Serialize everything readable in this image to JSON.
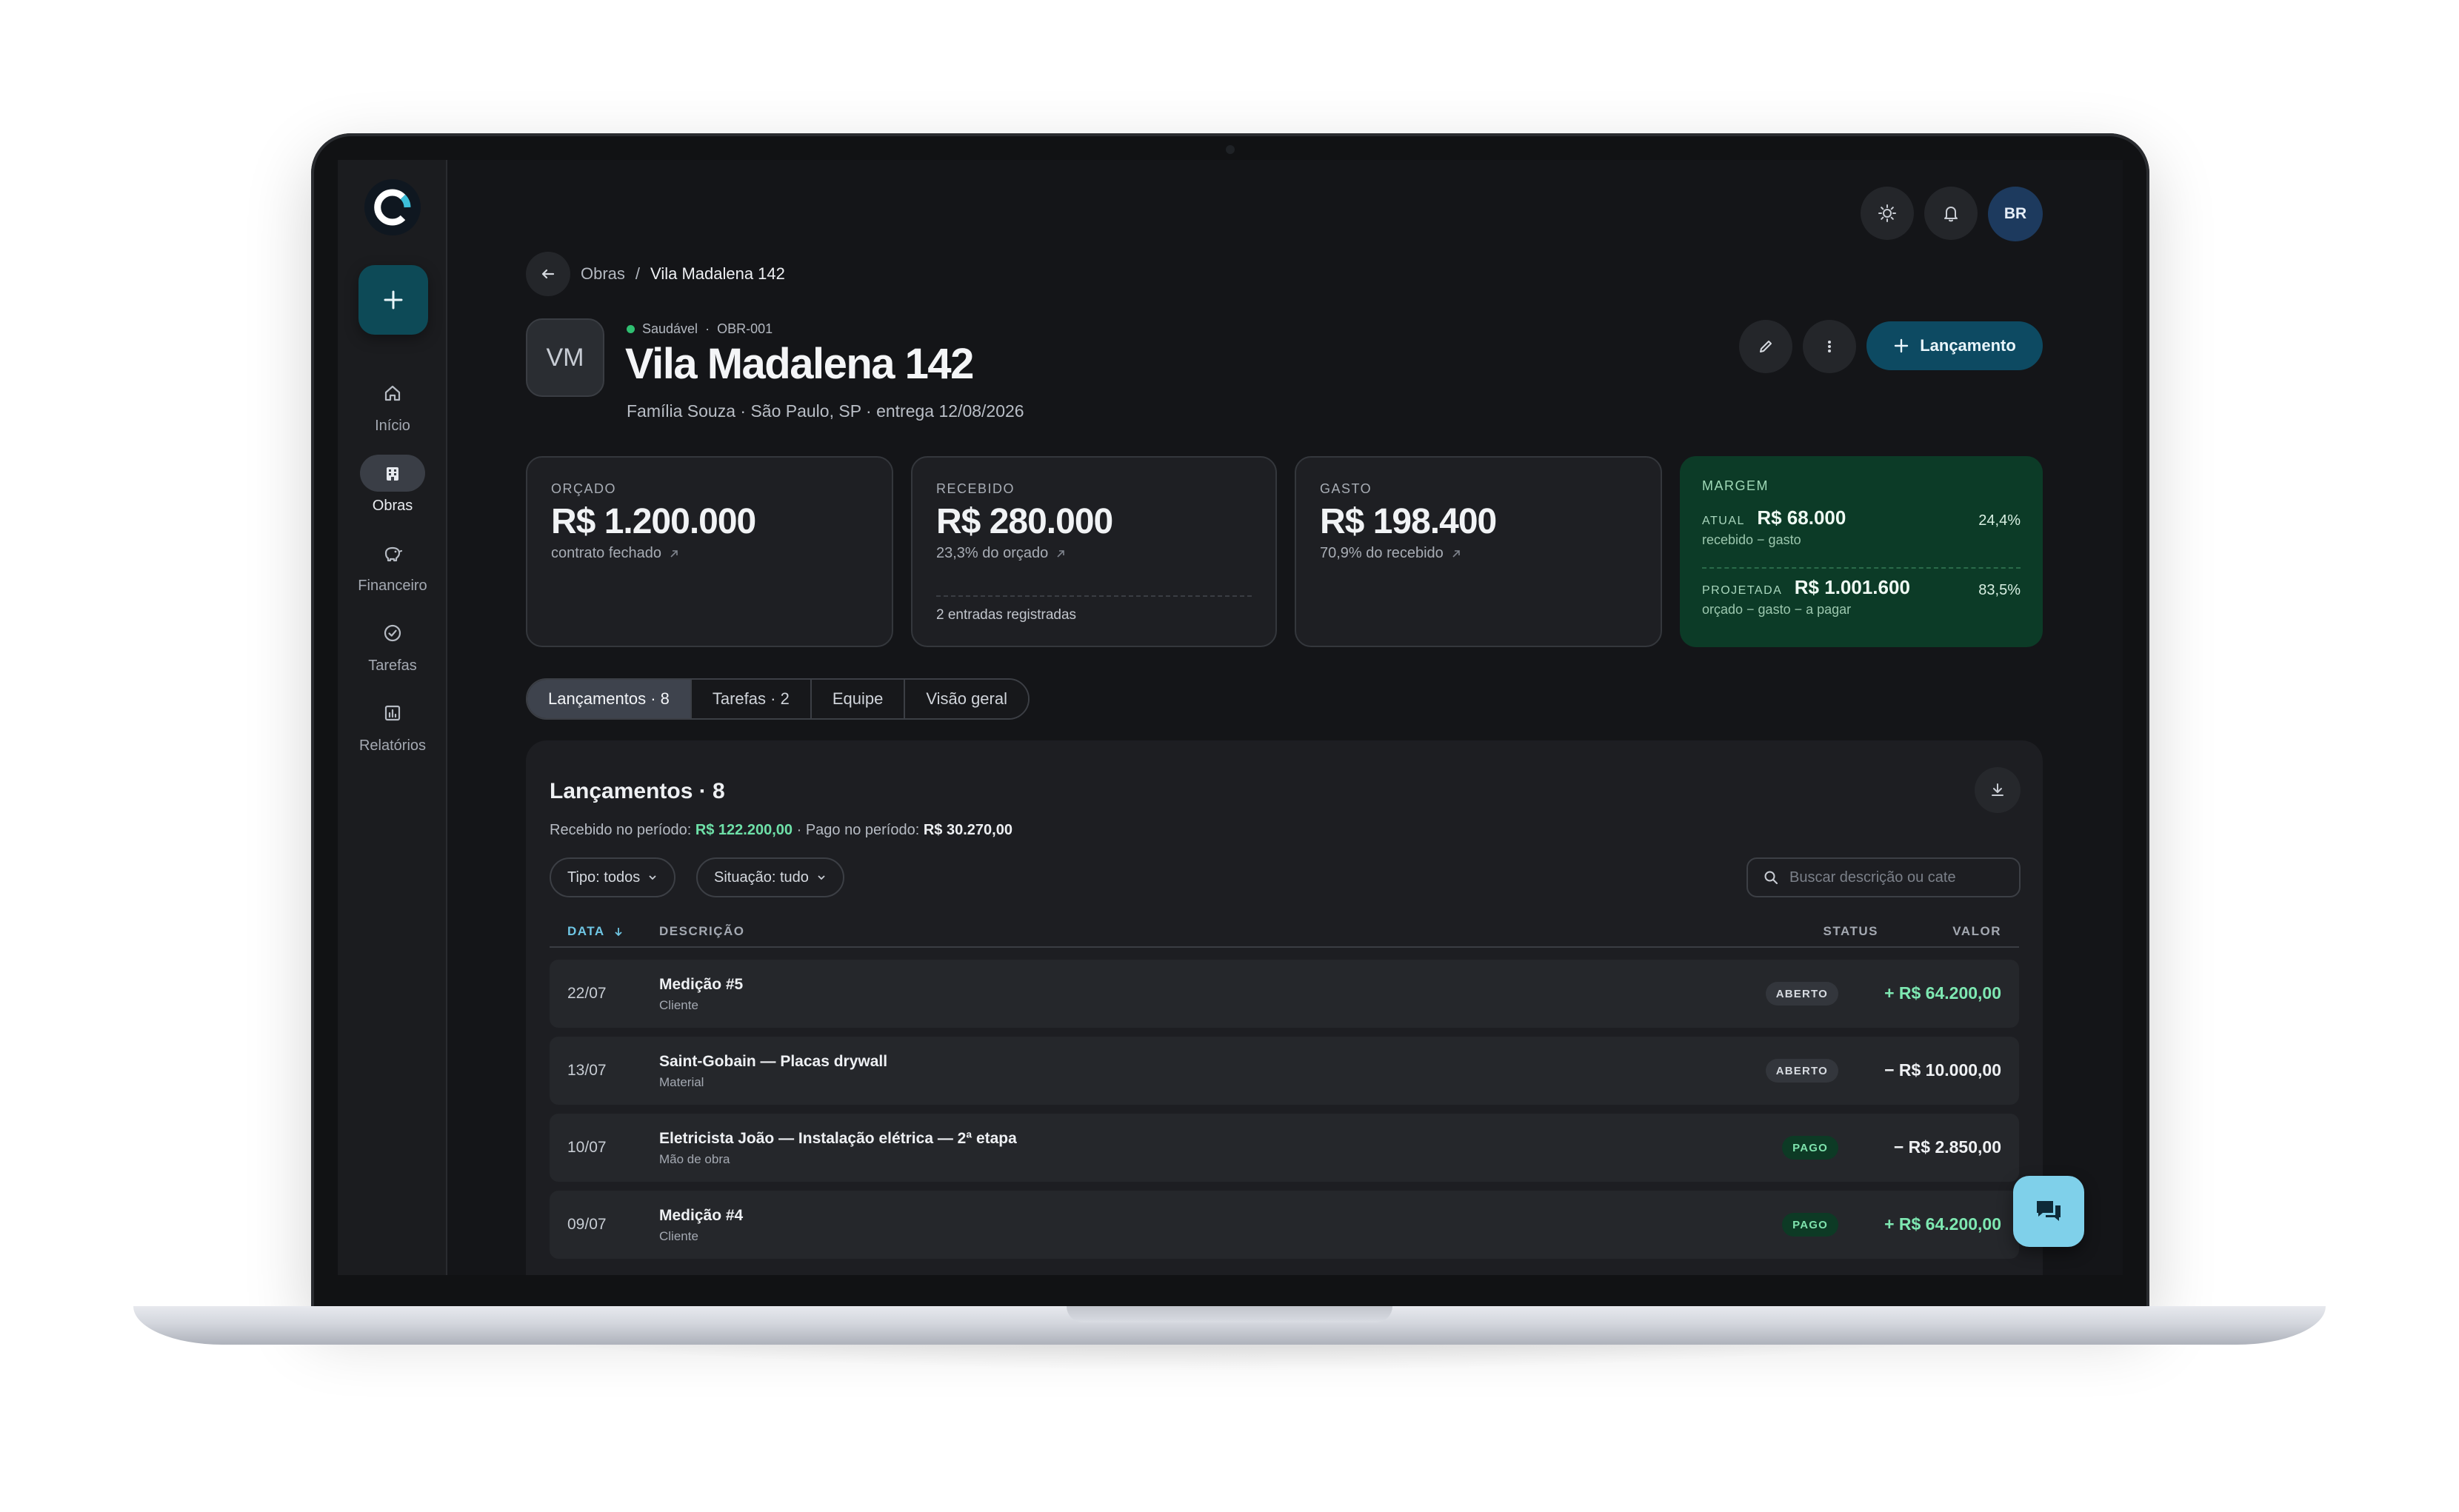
{
  "sidebar": {
    "items": [
      {
        "label": "Início",
        "icon": "home-icon"
      },
      {
        "label": "Obras",
        "icon": "buildings-icon",
        "active": true
      },
      {
        "label": "Financeiro",
        "icon": "piggy-bank-icon"
      },
      {
        "label": "Tarefas",
        "icon": "check-circle-icon"
      },
      {
        "label": "Relatórios",
        "icon": "bar-chart-icon"
      }
    ]
  },
  "topbar": {
    "avatar_initials": "BR"
  },
  "breadcrumb": {
    "parent": "Obras",
    "separator": "/",
    "current": "Vila Madalena 142"
  },
  "project": {
    "initials": "VM",
    "health": "Saudável",
    "code": "OBR-001",
    "title": "Vila Madalena 142",
    "subtitle": "Família Souza · São Paulo, SP · entrega 12/08/2026",
    "primary_action": "Lançamento"
  },
  "kpis": {
    "orcado": {
      "label": "ORÇADO",
      "value": "R$ 1.200.000",
      "note": "contrato fechado"
    },
    "recebido": {
      "label": "RECEBIDO",
      "value": "R$ 280.000",
      "note": "23,3% do orçado",
      "footer": "2 entradas registradas"
    },
    "gasto": {
      "label": "GASTO",
      "value": "R$ 198.400",
      "note": "70,9% do recebido"
    },
    "margem": {
      "label": "MARGEM",
      "atual": {
        "tag": "ATUAL",
        "value": "R$ 68.000",
        "pct": "24,4%",
        "formula": "recebido − gasto"
      },
      "projetada": {
        "tag": "PROJETADA",
        "value": "R$ 1.001.600",
        "pct": "83,5%",
        "formula": "orçado − gasto − a pagar"
      }
    }
  },
  "tabs": [
    {
      "label": "Lançamentos · 8",
      "active": true
    },
    {
      "label": "Tarefas · 2"
    },
    {
      "label": "Equipe"
    },
    {
      "label": "Visão geral"
    }
  ],
  "ledger": {
    "title": "Lançamentos · 8",
    "summary": {
      "received_label": "Recebido no período:",
      "received_value": "R$ 122.200,00",
      "paid_label": "· Pago no período:",
      "paid_value": "R$ 30.270,00"
    },
    "filters": {
      "type": "Tipo: todos",
      "status": "Situação: tudo"
    },
    "search_placeholder": "Buscar descrição ou cate",
    "columns": {
      "date": "DATA",
      "description": "DESCRIÇÃO",
      "status": "STATUS",
      "value": "VALOR"
    },
    "rows": [
      {
        "date": "22/07",
        "description": "Medição #5",
        "category": "Cliente",
        "status": "ABERTO",
        "value": "+ R$ 64.200,00",
        "kind": "pos"
      },
      {
        "date": "13/07",
        "description": "Saint-Gobain — Placas drywall",
        "category": "Material",
        "status": "ABERTO",
        "value": "− R$ 10.000,00",
        "kind": "neg"
      },
      {
        "date": "10/07",
        "description": "Eletricista João — Instalação elétrica — 2ª etapa",
        "category": "Mão de obra",
        "status": "PAGO",
        "value": "− R$ 2.850,00",
        "kind": "neg"
      },
      {
        "date": "09/07",
        "description": "Medição #4",
        "category": "Cliente",
        "status": "PAGO",
        "value": "+ R$ 64.200,00",
        "kind": "pos"
      }
    ]
  },
  "colors": {
    "accent": "#0d4a62",
    "positive": "#7ee8b2",
    "margin_card": "#0c3b27",
    "chat": "#7fd0ea"
  }
}
